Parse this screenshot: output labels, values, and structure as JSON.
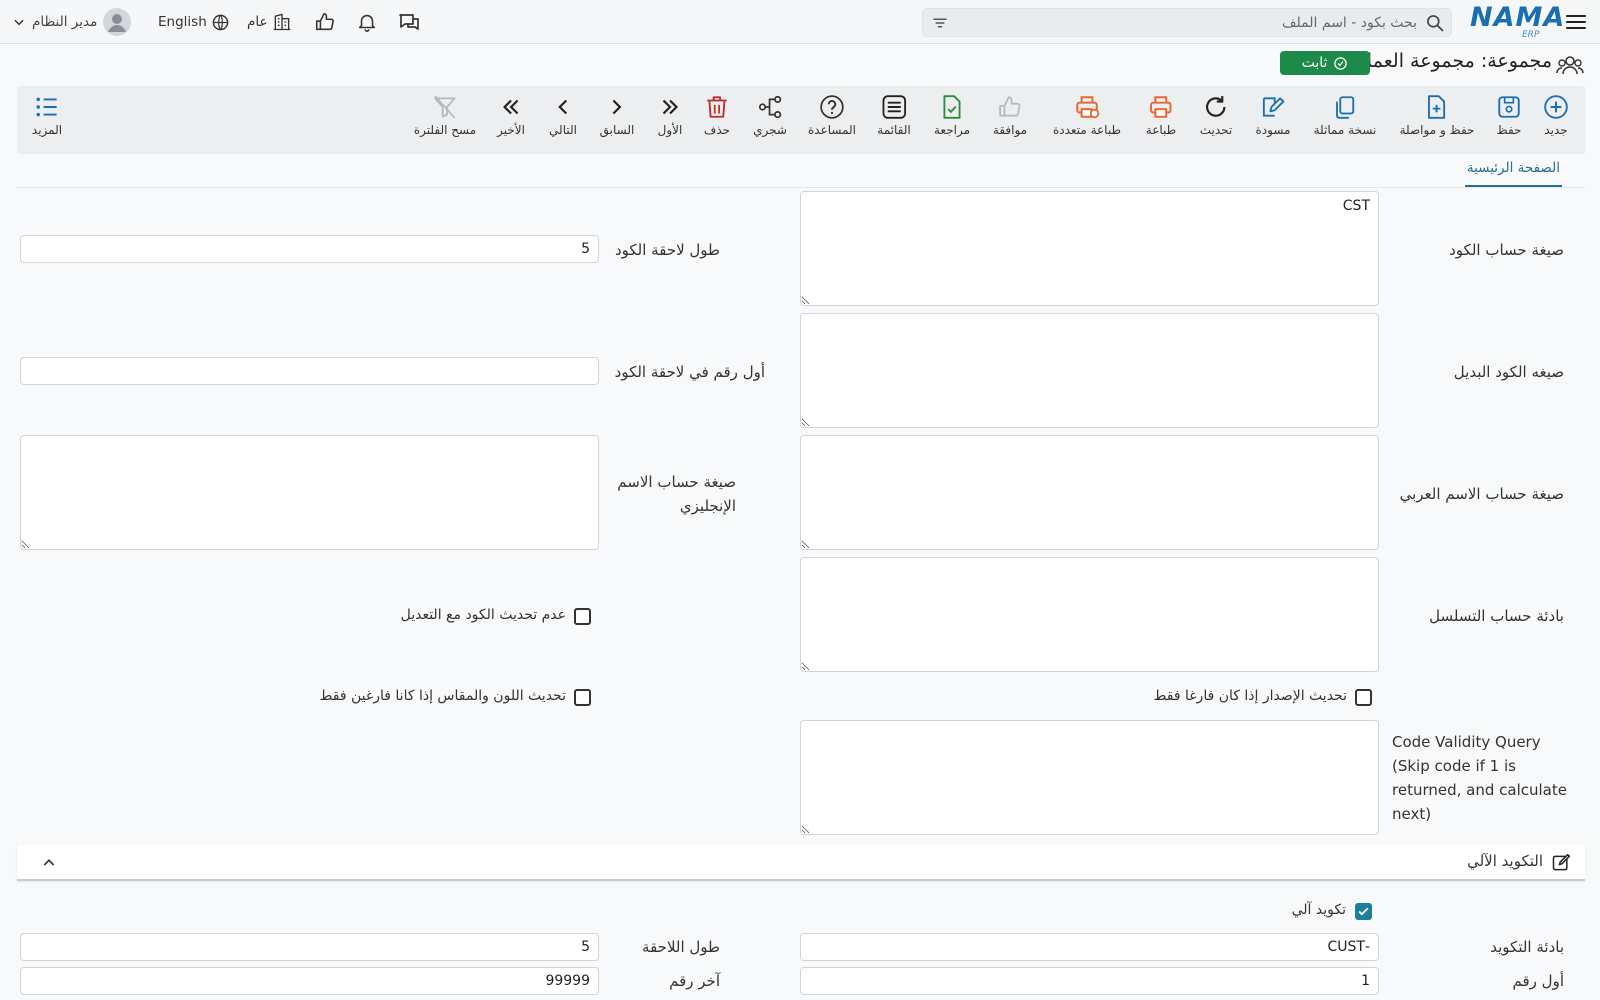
{
  "header": {
    "logo_text": "NAMA",
    "logo_sub": "ERP",
    "search_placeholder": "بحث بكود - اسم الملف",
    "user_name": "مدير النظام",
    "language": "English",
    "branch": "عام"
  },
  "page": {
    "title": "مجموعة: مجموعة العملاء",
    "status_badge": "ثابت"
  },
  "toolbar": {
    "items": [
      {
        "label": "جديد",
        "icon": "plus-circle-icon"
      },
      {
        "label": "حفظ",
        "icon": "save-icon"
      },
      {
        "label": "حفظ و مواصلة",
        "icon": "save-continue-icon"
      },
      {
        "label": "نسخة مماثلة",
        "icon": "copy-icon"
      },
      {
        "label": "مسودة",
        "icon": "draft-icon"
      },
      {
        "label": "تحديث",
        "icon": "refresh-icon"
      },
      {
        "label": "طباعة",
        "icon": "print-icon"
      },
      {
        "label": "طباعة متعددة",
        "icon": "multi-print-icon"
      },
      {
        "label": "موافقة",
        "icon": "thumbs-up-icon"
      },
      {
        "label": "مراجعة",
        "icon": "review-icon"
      },
      {
        "label": "القائمة",
        "icon": "list-icon"
      },
      {
        "label": "المساعدة",
        "icon": "help-icon"
      },
      {
        "label": "شجري",
        "icon": "tree-icon"
      },
      {
        "label": "حذف",
        "icon": "trash-icon"
      },
      {
        "label": "الأول",
        "icon": "first-icon"
      },
      {
        "label": "السابق",
        "icon": "previous-icon"
      },
      {
        "label": "التالي",
        "icon": "next-icon"
      },
      {
        "label": "الأخير",
        "icon": "last-icon"
      },
      {
        "label": "مسح الفلترة",
        "icon": "clear-filter-icon"
      }
    ],
    "more_label": "المزيد"
  },
  "tabs": {
    "main": "الصفحة الرئيسية"
  },
  "form": {
    "code_formula_label": "صيغة حساب الكود",
    "code_formula_value": "CST",
    "suffix_length_label": "طول لاحقة الكود",
    "suffix_length_value": "5",
    "alt_code_label": "صيغه الكود البديل",
    "alt_code_value": "",
    "first_suffix_num_label": "أول رقم في لاحقة الكود",
    "first_suffix_num_value": "",
    "arabic_name_label": "صيغة حساب الاسم العربي",
    "arabic_name_value": "",
    "english_name_label": "صيغة حساب الاسم الإنجليزي",
    "english_name_value": "",
    "sequence_prefix_label": "بادئة حساب التسلسل",
    "sequence_prefix_value": "",
    "no_update_code_label": "عدم تحديث الكود مع التعديل",
    "update_version_label": "تحديث الإصدار إذا كان فارغا فقط",
    "update_color_size_label": "تحديث اللون والمقاس إذا كانا فارغين فقط",
    "validity_query_label": "Code Validity Query (Skip code if 1 is returned, and calculate next)",
    "validity_query_value": ""
  },
  "auto_coding": {
    "section_title": "التكويد الآلي",
    "auto_code_label": "تكويد آلي",
    "auto_code_checked": true,
    "prefix_label": "بادئة التكويد",
    "prefix_value": "-CUST",
    "suffix_length_label": "طول اللاحقة",
    "suffix_length_value": "5",
    "first_number_label": "أول رقم",
    "first_number_value": "1",
    "last_number_label": "آخر رقم",
    "last_number_value": "99999"
  },
  "colors": {
    "brand": "#1a6fb0",
    "badge": "#1e8a4a",
    "accent": "#2b6f8e",
    "print": "#e8672c",
    "delete": "#c62828",
    "review": "#2e8b3e"
  }
}
